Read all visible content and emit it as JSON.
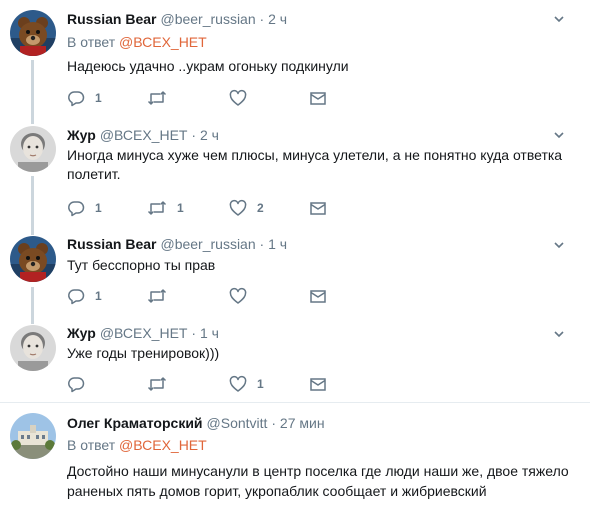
{
  "tweets": [
    {
      "name": "Russian Bear",
      "handle": "@beer_russian",
      "dot": "·",
      "time": "2 ч",
      "reply_prefix": "В ответ",
      "reply_to": "@ВСЕХ_НЕТ",
      "text": "Надеюсь удачно ..украм огоньку подкинули",
      "reply_count": "1",
      "retweet_count": "",
      "like_count": "",
      "avatar": "bear"
    },
    {
      "name": "Жур",
      "handle": "@ВСЕХ_НЕТ",
      "dot": "·",
      "time": "2 ч",
      "text": "Иногда минуса хуже чем плюсы, минуса улетели, а не понятно куда ответка полетит.",
      "reply_count": "1",
      "retweet_count": "1",
      "like_count": "2",
      "avatar": "boy"
    },
    {
      "name": "Russian Bear",
      "handle": "@beer_russian",
      "dot": "·",
      "time": "1 ч",
      "text": "Тут бесспорно ты прав",
      "reply_count": "1",
      "retweet_count": "",
      "like_count": "",
      "avatar": "bear"
    },
    {
      "name": "Жур",
      "handle": "@ВСЕХ_НЕТ",
      "dot": "·",
      "time": "1 ч",
      "text": "Уже годы тренировок)))",
      "reply_count": "",
      "retweet_count": "",
      "like_count": "1",
      "avatar": "boy"
    },
    {
      "name": "Олег Краматорский",
      "handle": "@Sontvitt",
      "dot": "·",
      "time": "27 мин",
      "reply_prefix": "В ответ",
      "reply_to": "@ВСЕХ_НЕТ",
      "text": "Достойно наши минусанули в центр поселка где люди наши же, двое тяжело раненых пять домов горит, укропаблик сообщает и жибриевский",
      "avatar": "building"
    }
  ],
  "icons": {
    "reply": "reply-icon",
    "retweet": "retweet-icon",
    "like": "heart-icon",
    "dm": "envelope-icon",
    "caret": "chevron-down-icon"
  },
  "colors": {
    "link": "#e0663a",
    "muted": "#657786",
    "thread_line": "#ccd6dd"
  }
}
